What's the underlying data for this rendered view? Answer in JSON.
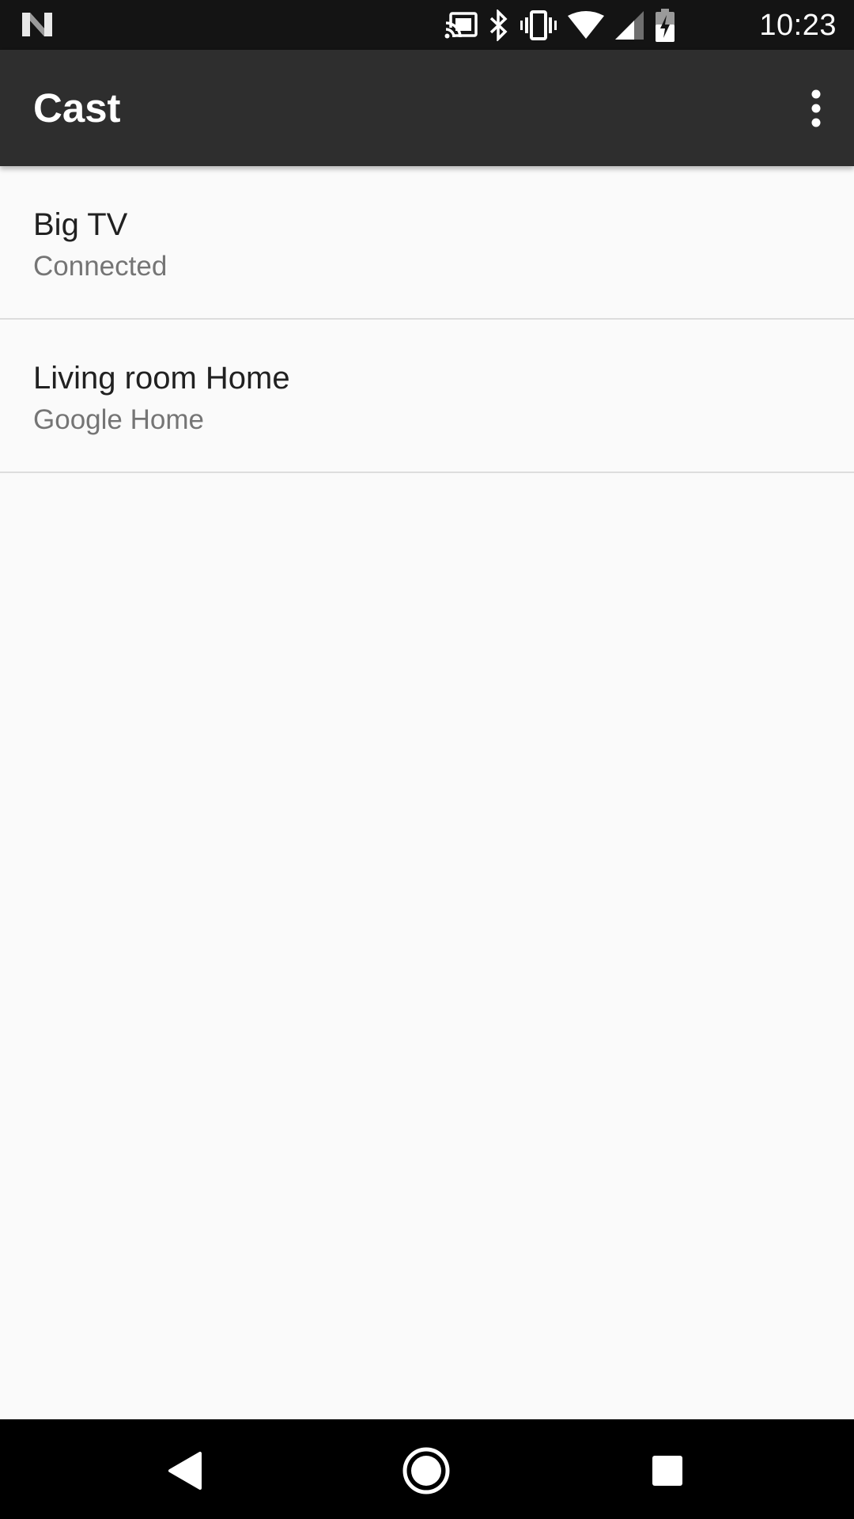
{
  "status_bar": {
    "time": "10:23",
    "icons": [
      "android-n-icon",
      "cast-connected-icon",
      "bluetooth-icon",
      "vibrate-icon",
      "wifi-icon",
      "cell-signal-icon",
      "battery-charging-icon"
    ]
  },
  "app_bar": {
    "title": "Cast",
    "overflow_icon": "more-vert-icon"
  },
  "devices": [
    {
      "name": "Big TV",
      "status": "Connected"
    },
    {
      "name": "Living room Home",
      "status": "Google Home"
    }
  ],
  "nav_bar": {
    "icons": [
      "back-icon",
      "home-icon",
      "recents-icon"
    ]
  },
  "colors": {
    "status_bar_bg": "#141414",
    "app_bar_bg": "#2e2e2e",
    "list_bg": "#fafafa",
    "divider": "#dddddd",
    "primary_text": "#212121",
    "secondary_text": "#757575",
    "nav_bar_bg": "#000000"
  }
}
